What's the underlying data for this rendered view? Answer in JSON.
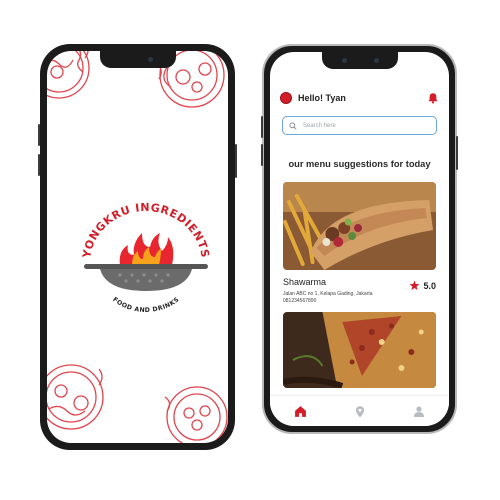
{
  "splash": {
    "brand_top": "YONGKRU INGREDIENTS",
    "brand_bottom": "FOOD AND DRINKS"
  },
  "app": {
    "greeting": "Hello! Tyan",
    "search": {
      "placeholder": "Search here"
    },
    "section_title": "our menu suggestions for today",
    "items": [
      {
        "name": "Shawarma",
        "address_line1": "Jalan ABC no 1, Kelapa Gading, Jakarta",
        "address_line2": "081234567890",
        "rating": "5.0"
      }
    ],
    "nav": [
      "home-icon",
      "location-pin-icon",
      "user-icon"
    ]
  },
  "colors": {
    "accent": "#d11e29",
    "search_border": "#6aa6d8",
    "frame": "#1b1b1b"
  }
}
